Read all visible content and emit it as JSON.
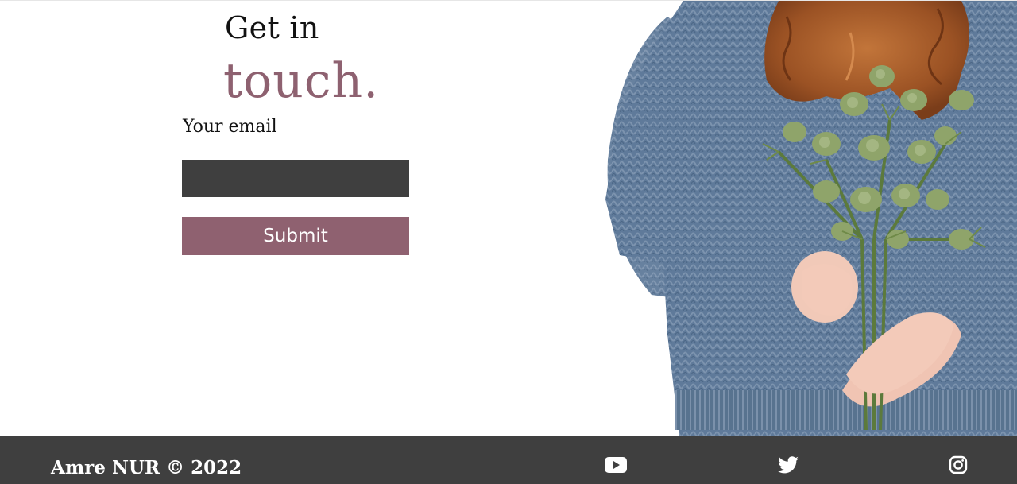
{
  "heading": {
    "line1": "Get in",
    "line2": "touch."
  },
  "form": {
    "email_label": "Your email",
    "email_value": "",
    "submit_label": "Submit"
  },
  "footer": {
    "copyright": "Amre NUR © 2022",
    "social_icons": [
      "youtube-icon",
      "twitter-icon",
      "instagram-icon"
    ]
  },
  "colors": {
    "accent": "#8f6170",
    "dark": "#3f3f3f",
    "background": "#ffffff"
  }
}
